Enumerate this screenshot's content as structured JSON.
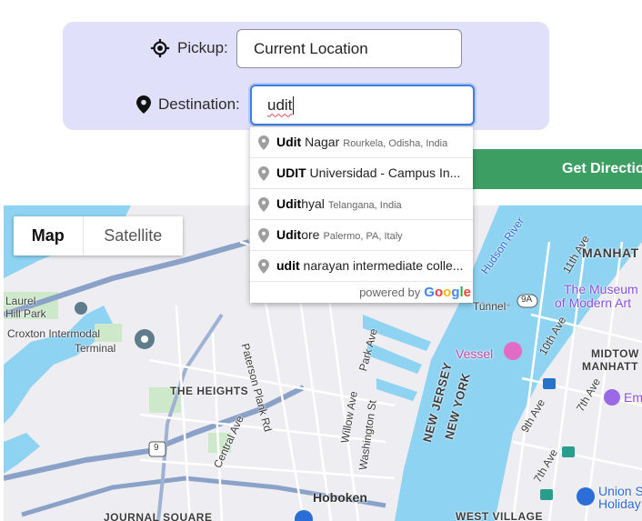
{
  "form": {
    "pickup_label": "Pickup:",
    "pickup_value": "Current Location",
    "destination_label": "Destination:",
    "destination_value": "udit",
    "get_directions_label": "Get Directions"
  },
  "autocomplete": {
    "suggestions": [
      {
        "match": "Udit",
        "rest": " Nagar",
        "secondary": "Rourkela, Odisha, India"
      },
      {
        "match": "UDIT",
        "rest": " Universidad - Campus In...",
        "secondary": ""
      },
      {
        "match": "Udit",
        "rest": "hyal",
        "secondary": "Telangana, India"
      },
      {
        "match": "Udit",
        "rest": "ore",
        "secondary": "Palermo, PA, Italy"
      },
      {
        "match": "udit",
        "rest": " narayan intermediate colle...",
        "secondary": ""
      }
    ],
    "powered_by": "powered by",
    "google_letters": [
      "G",
      "o",
      "o",
      "g",
      "l",
      "e"
    ],
    "google_colors": [
      "#4285F4",
      "#EA4335",
      "#FBBC05",
      "#4285F4",
      "#34A853",
      "#EA4335"
    ]
  },
  "map": {
    "type_buttons": {
      "map": "Map",
      "satellite": "Satellite"
    },
    "labels": {
      "laurel_hill": "Laurel\nHill Park",
      "croxton": "Croxton Intermodal",
      "terminal": "Terminal",
      "the_heights": "THE HEIGHTS",
      "paterson": "Paterson Plank Rd",
      "park_ave": "Park Ave",
      "willow": "Willow Ave",
      "washington": "Washington St",
      "central": "Central Ave",
      "new_jersey": "NEW JERSEY",
      "new_york": "NEW YORK",
      "vessel": "Vessel",
      "hudson": "Hudson River",
      "tunnel": "Tunnel",
      "eleventh": "11th Ave",
      "tenth": "10th Ave",
      "ninth": "9th Ave",
      "seventh": "7th Ave",
      "seventh2": "7th Ave",
      "manhattan": "MANHAT",
      "museum1": "The Museum",
      "museum2": "of Modern Art",
      "midtown1": "MIDTOW",
      "midtown2": "MANHATT",
      "em": "Em",
      "hoboken": "Hoboken",
      "journal": "JOURNAL SQUARE",
      "west_village": "WEST VILLAGE",
      "union1": "Union S",
      "union2": "Holiday",
      "route9": "9",
      "route9a": "9A"
    }
  },
  "colors": {
    "panel_bg": "#e0e0fb",
    "button_green": "#3c9e63",
    "focus_blue": "#3d7fe0",
    "water": "#8ed3f2"
  }
}
